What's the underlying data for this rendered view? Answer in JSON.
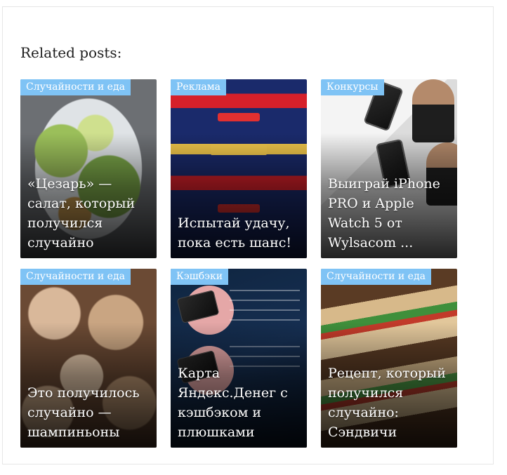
{
  "section": {
    "heading": "Related posts:"
  },
  "posts": [
    {
      "category": "Случайности и еда",
      "title": "«Цезарь» — салат, который получился случайно",
      "thumb_icon": "salad-image"
    },
    {
      "category": "Реклама",
      "title": "Испытай удачу, пока есть шанс!",
      "thumb_icon": "slot-machine-image"
    },
    {
      "category": "Конкурсы",
      "title": "Выиграй iPhone PRO и Apple Watch 5 от Wylsacom ...",
      "thumb_icon": "iphone-giveaway-image"
    },
    {
      "category": "Случайности и еда",
      "title": "Это получилось случайно — шампиньоны",
      "thumb_icon": "mushrooms-image"
    },
    {
      "category": "Кэшбэки",
      "title": "Карта Яндекс.Денег с кэшбэком и плюшками",
      "thumb_icon": "bank-card-image"
    },
    {
      "category": "Случайности и еда",
      "title": "Рецепт, который получился случайно: Сэндвичи",
      "thumb_icon": "sandwich-image"
    }
  ],
  "colors": {
    "category_badge": "#7fc3f5",
    "title_text": "#ffffff",
    "heading_text": "#1d1d1d"
  }
}
